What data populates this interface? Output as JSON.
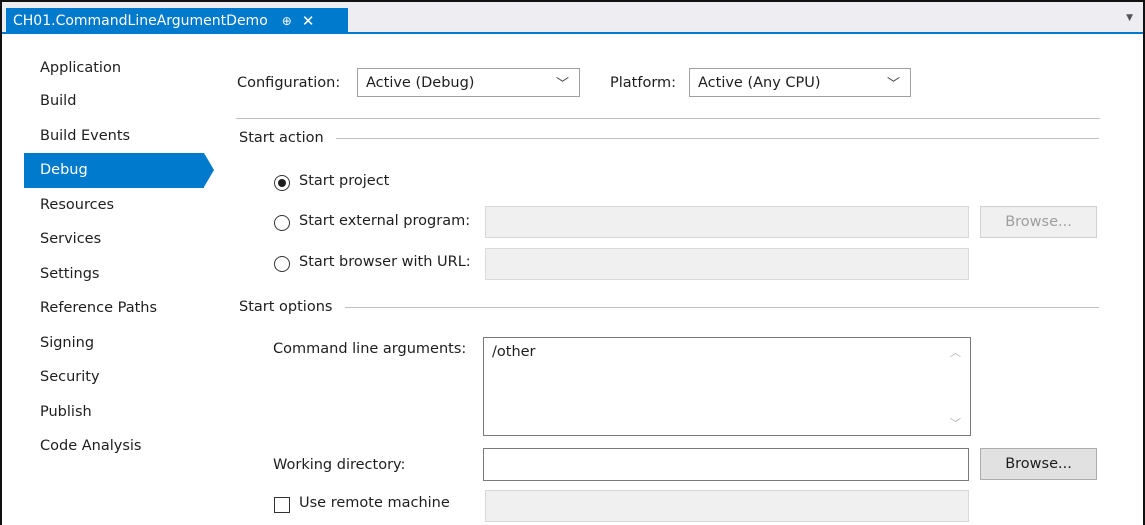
{
  "tab": {
    "title": "CH01.CommandLineArgumentDemo",
    "pin_glyph": "⊕",
    "close_glyph": "✕"
  },
  "sidebar": {
    "items": [
      {
        "label": "Application"
      },
      {
        "label": "Build"
      },
      {
        "label": "Build Events"
      },
      {
        "label": "Debug",
        "active": true
      },
      {
        "label": "Resources"
      },
      {
        "label": "Services"
      },
      {
        "label": "Settings"
      },
      {
        "label": "Reference Paths"
      },
      {
        "label": "Signing"
      },
      {
        "label": "Security"
      },
      {
        "label": "Publish"
      },
      {
        "label": "Code Analysis"
      }
    ]
  },
  "config": {
    "configuration_label": "Configuration:",
    "configuration_value": "Active (Debug)",
    "platform_label": "Platform:",
    "platform_value": "Active (Any CPU)"
  },
  "start_action": {
    "heading": "Start action",
    "start_project": "Start project",
    "start_external": "Start external program:",
    "start_browser": "Start browser with URL:",
    "browse_label": "Browse...",
    "selected": "start_project"
  },
  "start_options": {
    "heading": "Start options",
    "cmd_args_label": "Command line arguments:",
    "cmd_args_value": "/other",
    "working_dir_label": "Working directory:",
    "working_dir_value": "",
    "browse_label": "Browse...",
    "remote_label": "Use remote machine",
    "remote_checked": false
  },
  "colors": {
    "accent": "#007acc"
  }
}
